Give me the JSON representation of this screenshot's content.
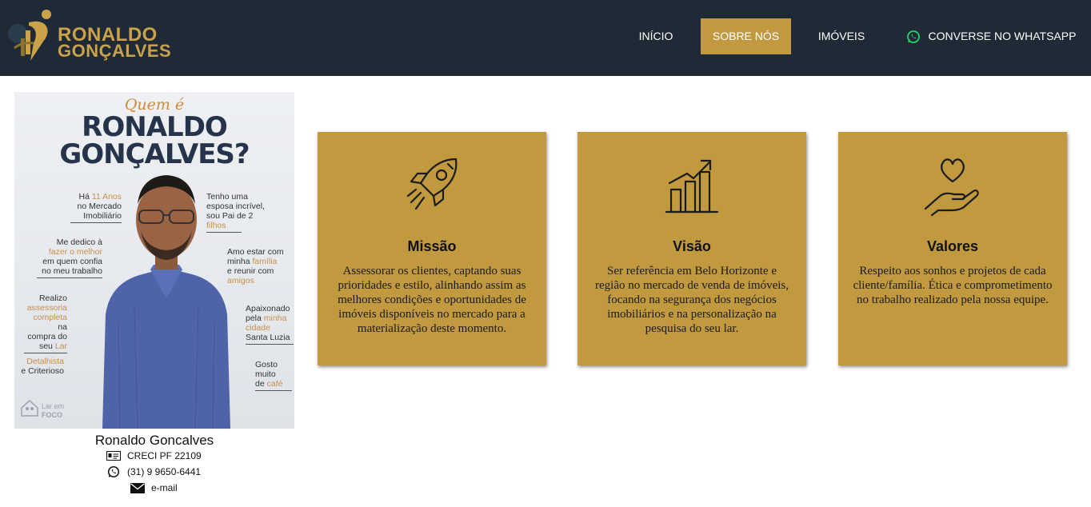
{
  "brand": {
    "line1": "RONALDO",
    "line2": "GONÇALVES",
    "gold": "#c9a24a",
    "header_bg": "#1f2a36"
  },
  "nav": {
    "inicio": "INÍCIO",
    "sobre": "SOBRE NÓS",
    "imoveis": "IMÓVEIS",
    "whatsapp": "CONVERSE NO WHATSAPP",
    "active_color": "#c1993e"
  },
  "profile_image": {
    "quem": "Quem é",
    "name1": "RONALDO",
    "name2": "GONÇALVES?",
    "facts": {
      "f1a": "Há ",
      "f1b": "11 Anos",
      "f1c": "no Mercado",
      "f1d": "Imobiliário",
      "f2a": "Me dedico à",
      "f2b": "fazer o melhor",
      "f2c": "em quem confia",
      "f2d": "no meu trabalho",
      "f3a": "Realizo",
      "f3b": "assessoria",
      "f3c": "completa",
      "f3d": " na",
      "f3e": "compra do",
      "f3f": "seu ",
      "f3g": "Lar",
      "f4a": "Detalhista",
      "f4b": "e Criterioso",
      "f5a": "Tenho uma",
      "f5b": "esposa incrível,",
      "f5c": "sou Pai de 2",
      "f5d": "filhos",
      "f6a": "Amo estar com",
      "f6b": "minha ",
      "f6c": "família",
      "f6d": "e reunir com",
      "f6e": "amigos",
      "f7a": "Apaixonado",
      "f7b": "pela ",
      "f7c": "minha",
      "f7d": "cidade",
      "f7e": "Santa Luzia",
      "f8a": "Gosto",
      "f8b": "muito",
      "f8c": "de ",
      "f8d": "café"
    },
    "lar_logo_a": "Lar em",
    "lar_logo_b": "FOCO"
  },
  "profile": {
    "name": "Ronaldo Goncalves",
    "creci": "CRECI PF 22109",
    "phone": "(31) 9 9650-6441",
    "email": "e-mail"
  },
  "cards": [
    {
      "icon": "rocket-icon",
      "title": "Missão",
      "text": "Assessorar os clientes, captando suas prioridades e estilo, alinhando assim as melhores condições e oportunidades de imóveis disponíveis no mercado para a materialização deste momento."
    },
    {
      "icon": "growth-chart-icon",
      "title": "Visão",
      "text": "Ser referência em Belo Horizonte e região no mercado de venda de imóveis, focando na segurança dos negócios imobiliários e na personalização na pesquisa do seu lar."
    },
    {
      "icon": "heart-hand-icon",
      "title": "Valores",
      "text": "Respeito aos sonhos e projetos de cada cliente/família. Ética e comprometimento no trabalho realizado pela nossa equipe."
    }
  ]
}
